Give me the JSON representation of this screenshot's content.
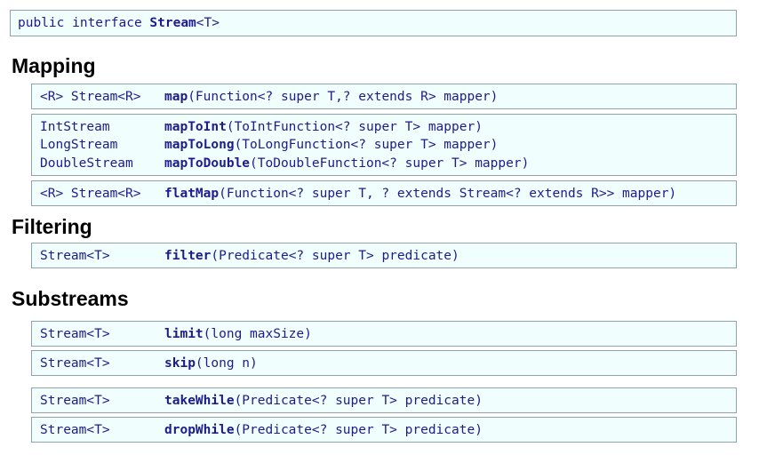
{
  "header": {
    "prefix": "public interface ",
    "name": "Stream",
    "suffix": "<T>"
  },
  "sections": {
    "mapping": "Mapping",
    "filtering": "Filtering",
    "substreams": "Substreams"
  },
  "methods": {
    "map": {
      "rtype": "<R> Stream<R>",
      "name": "map",
      "params": "(Function<? super T,? extends R> mapper)"
    },
    "mapToInt": {
      "rtype": "IntStream",
      "name": "mapToInt",
      "params": "(ToIntFunction<? super T> mapper)"
    },
    "mapToLong": {
      "rtype": "LongStream",
      "name": "mapToLong",
      "params": "(ToLongFunction<? super T> mapper)"
    },
    "mapToDouble": {
      "rtype": "DoubleStream",
      "name": "mapToDouble",
      "params": "(ToDoubleFunction<? super T> mapper)"
    },
    "flatMap": {
      "rtype": "<R> Stream<R>",
      "name": "flatMap",
      "params": "(Function<? super T, ? extends Stream<? extends R>> mapper)"
    },
    "filter": {
      "rtype": "Stream<T>",
      "name": "filter",
      "params": "(Predicate<? super T> predicate)"
    },
    "limit": {
      "rtype": "Stream<T>",
      "name": "limit",
      "params": "(long maxSize)"
    },
    "skip": {
      "rtype": "Stream<T>",
      "name": "skip",
      "params": "(long n)"
    },
    "takeWhile": {
      "rtype": "Stream<T>",
      "name": "takeWhile",
      "params": "(Predicate<? super T> predicate)"
    },
    "dropWhile": {
      "rtype": "Stream<T>",
      "name": "dropWhile",
      "params": "(Predicate<? super T> predicate)"
    }
  }
}
